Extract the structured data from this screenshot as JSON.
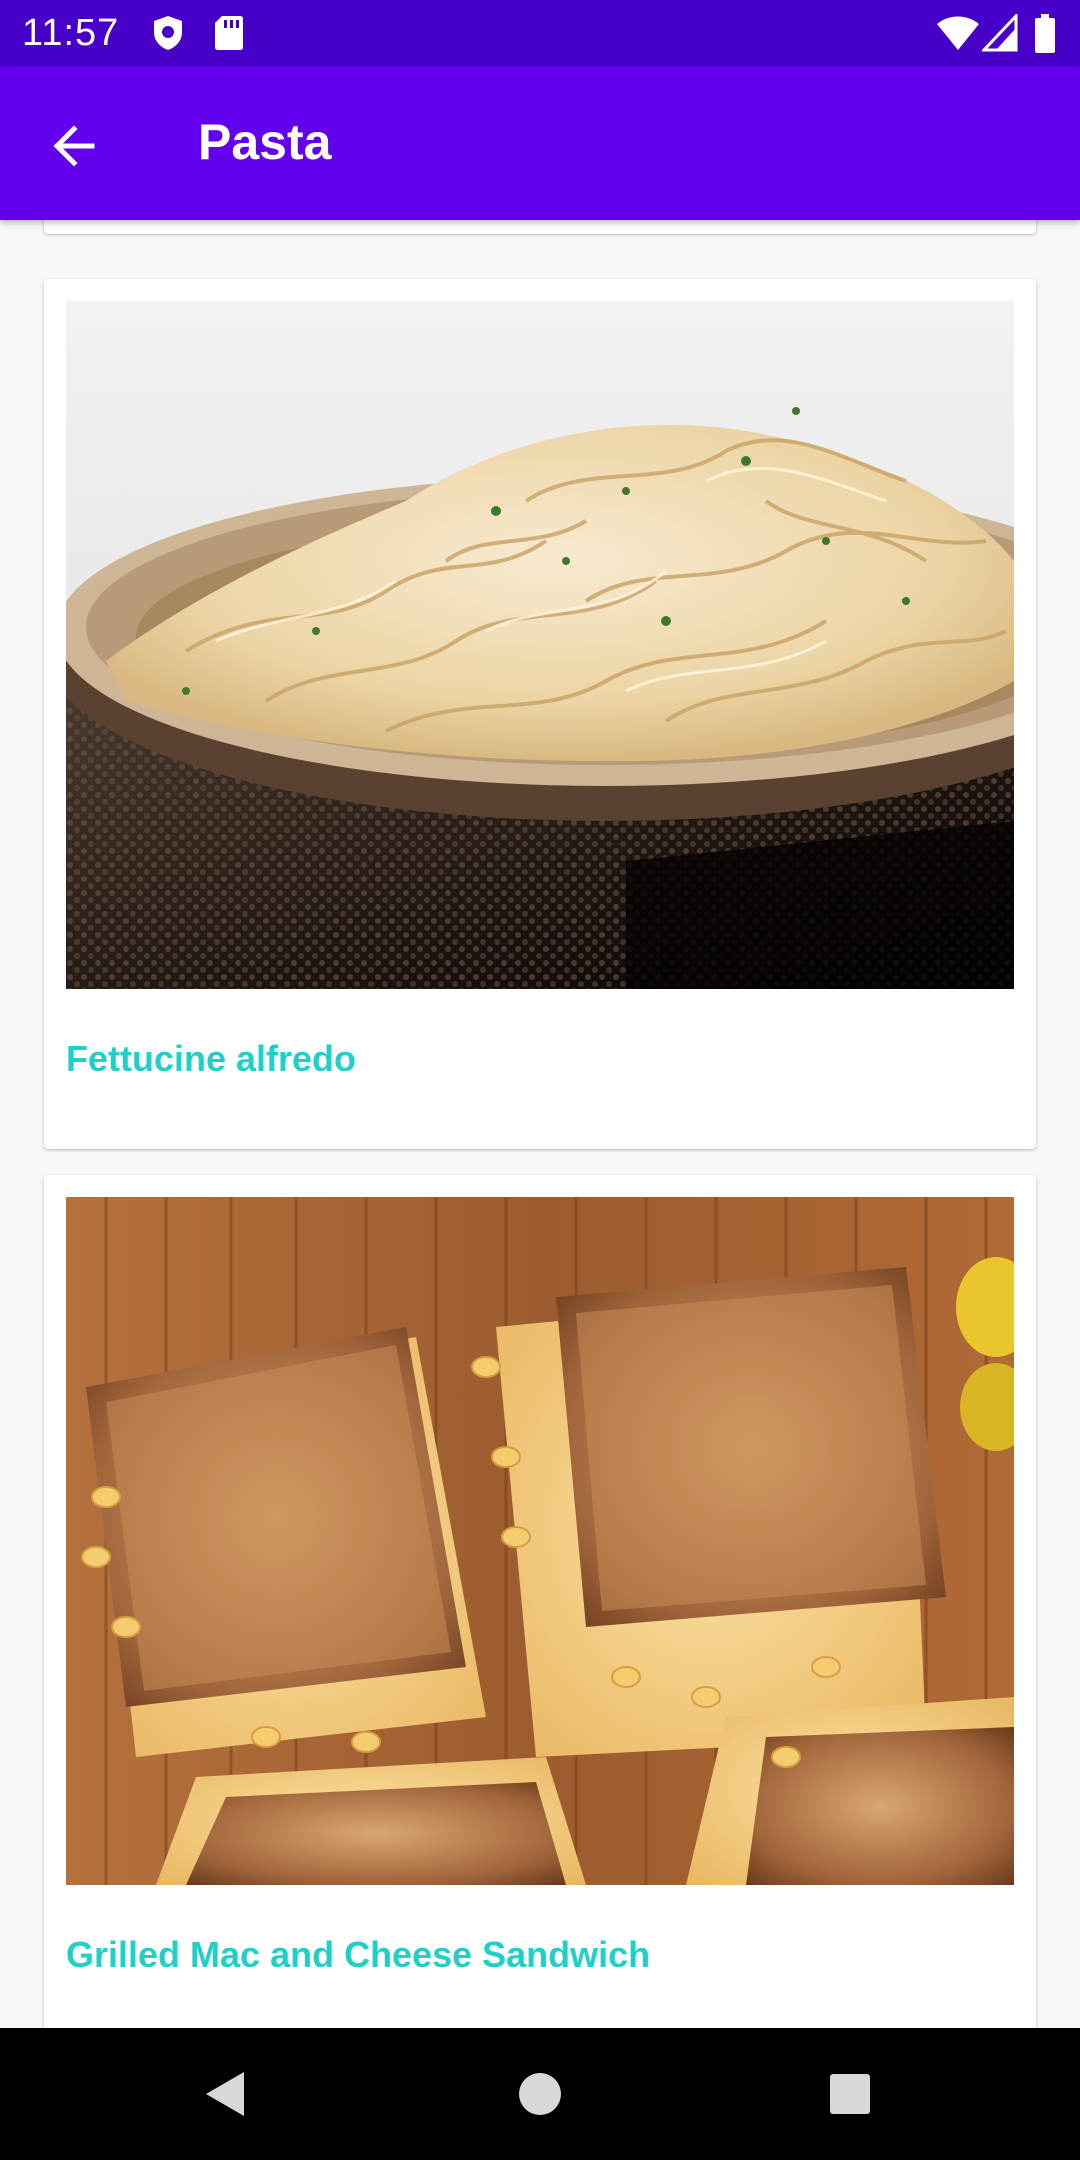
{
  "status_bar": {
    "time": "11:57",
    "left_icons": [
      "shield-icon",
      "sd-card-icon"
    ],
    "right_icons": [
      "wifi-icon",
      "cellular-signal-icon",
      "battery-icon"
    ]
  },
  "app_bar": {
    "title": "Pasta",
    "back_icon": "arrow-back-icon",
    "background": "#6200ee"
  },
  "colors": {
    "status_bar": "#4700c8",
    "title_accent": "#1fd0c6"
  },
  "recipes": [
    {
      "title": "Fettucine alfredo",
      "image": "fettuccine-alfredo-photo"
    },
    {
      "title": "Grilled Mac and Cheese Sandwich",
      "image": "grilled-mac-cheese-sandwich-photo"
    }
  ],
  "nav_bar": {
    "buttons": [
      "back-triangle-icon",
      "home-circle-icon",
      "recents-square-icon"
    ]
  }
}
